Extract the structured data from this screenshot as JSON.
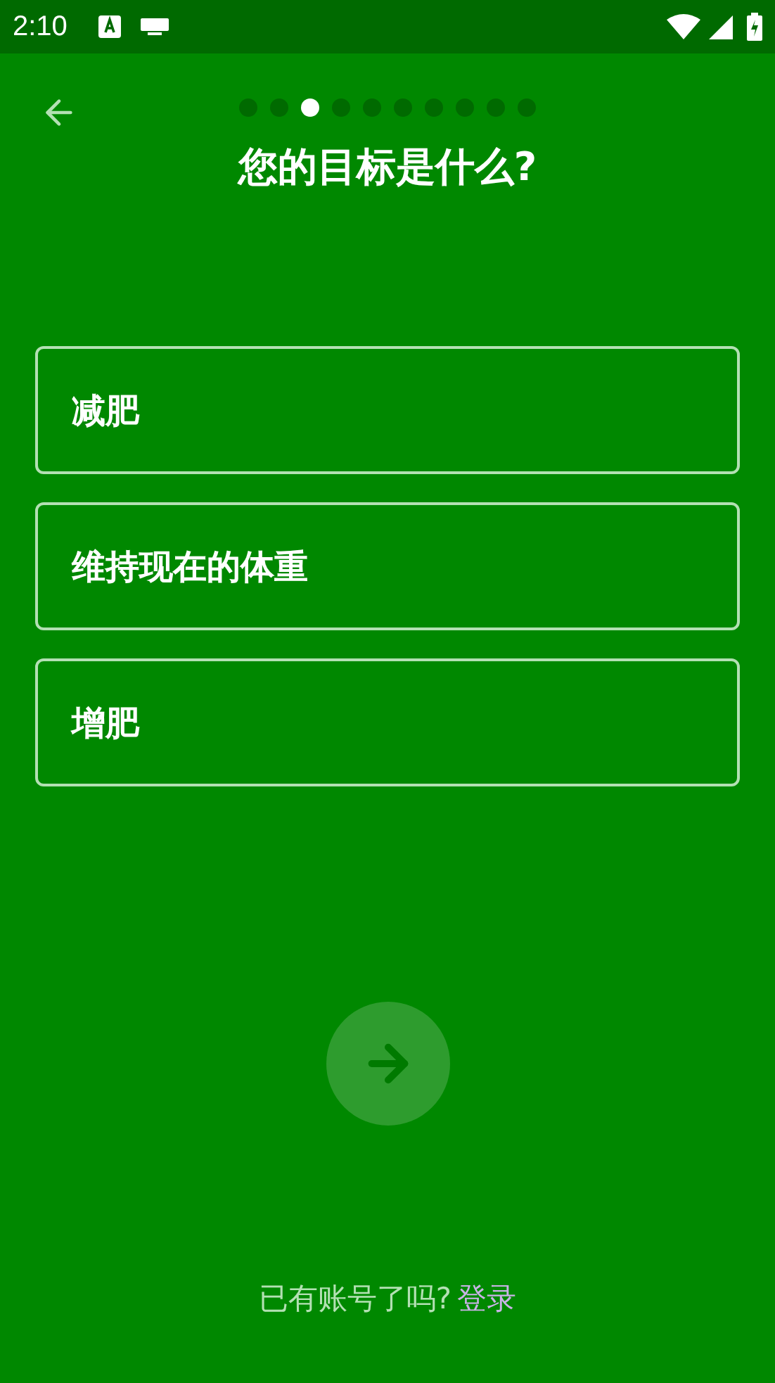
{
  "status_bar": {
    "time": "2:10"
  },
  "progress": {
    "steps": [
      {
        "selected": false
      },
      {
        "selected": false
      },
      {
        "selected": true
      },
      {
        "selected": false
      },
      {
        "selected": false
      },
      {
        "selected": false
      },
      {
        "selected": false
      },
      {
        "selected": false
      },
      {
        "selected": false
      },
      {
        "selected": false
      }
    ]
  },
  "title": "您的目标是什么?",
  "options": [
    {
      "label": "减肥",
      "selected": false
    },
    {
      "label": "维持现在的体重",
      "selected": false
    },
    {
      "label": "增肥",
      "selected": false
    }
  ],
  "next_button": {
    "disabled": true
  },
  "footer": {
    "text": "已有账号了吗?",
    "link": "登录"
  }
}
